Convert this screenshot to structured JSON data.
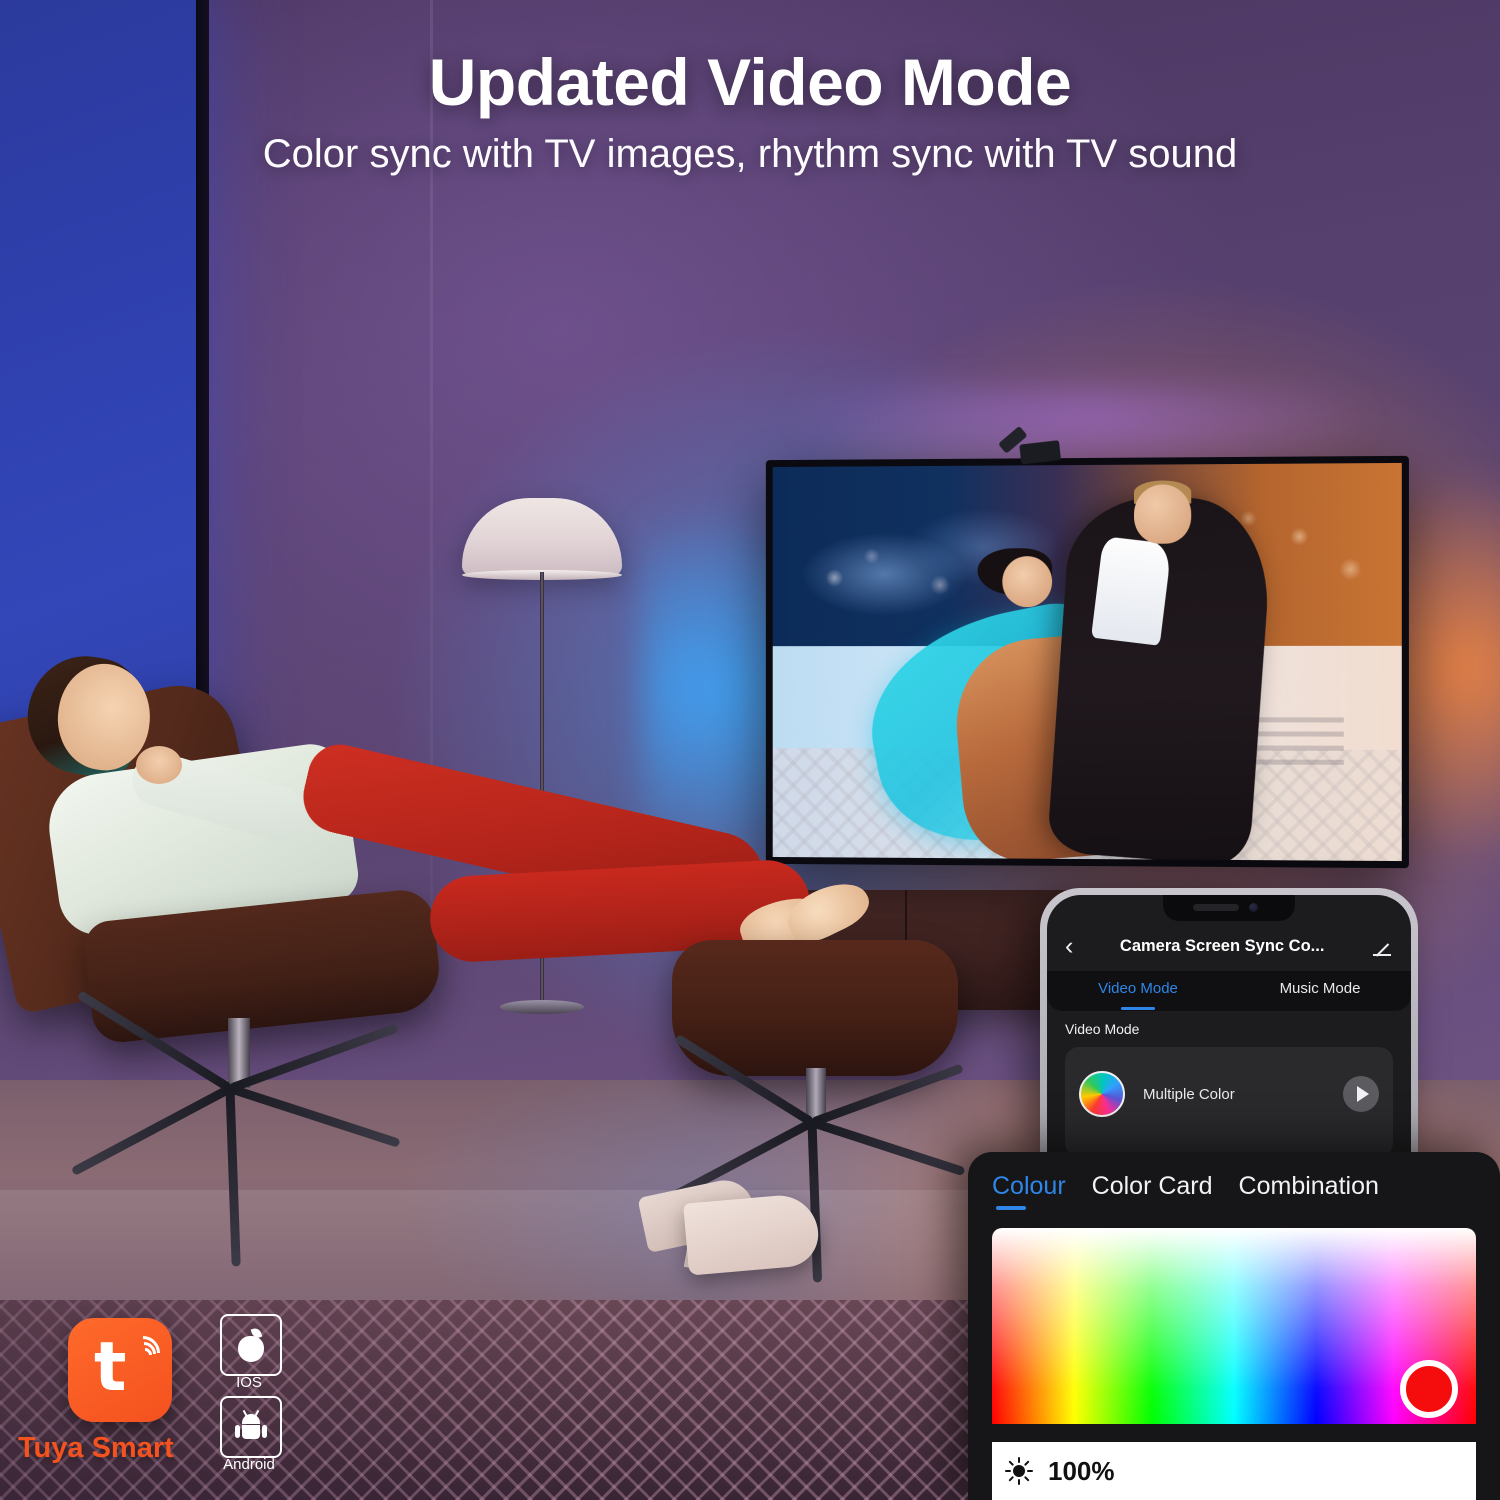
{
  "hero": {
    "title": "Updated Video Mode",
    "subtitle": "Color sync with TV images, rhythm sync with TV sound"
  },
  "phone": {
    "back_icon": "‹",
    "title": "Camera Screen Sync Co...",
    "edit_icon": "edit-pencil-icon",
    "tabs": [
      {
        "label": "Video Mode",
        "active": true
      },
      {
        "label": "Music Mode",
        "active": false
      }
    ],
    "section_label": "Video Mode",
    "mode_card": {
      "swatch_icon": "rainbow-gradient-circle-icon",
      "name": "Multiple Color",
      "play_icon": "play-icon"
    }
  },
  "color_panel": {
    "tabs": [
      {
        "label": "Colour",
        "active": true
      },
      {
        "label": "Color Card",
        "active": false
      },
      {
        "label": "Combination",
        "active": false
      }
    ],
    "selected_color": "#f50d0d",
    "brightness": {
      "icon": "brightness-sun-icon",
      "value": "100%"
    }
  },
  "badges": {
    "app_name": "Tuya Smart",
    "app_icon": "tuya-smart-logo",
    "platforms": [
      {
        "label": "IOS",
        "icon": "apple-icon"
      },
      {
        "label": "Android",
        "icon": "android-robot-icon"
      }
    ]
  },
  "colors": {
    "accent_blue": "#2f86e8",
    "tuya_orange": "#f4521e",
    "glow_warm": "#ff8c3c",
    "glow_cool": "#3caaff"
  }
}
